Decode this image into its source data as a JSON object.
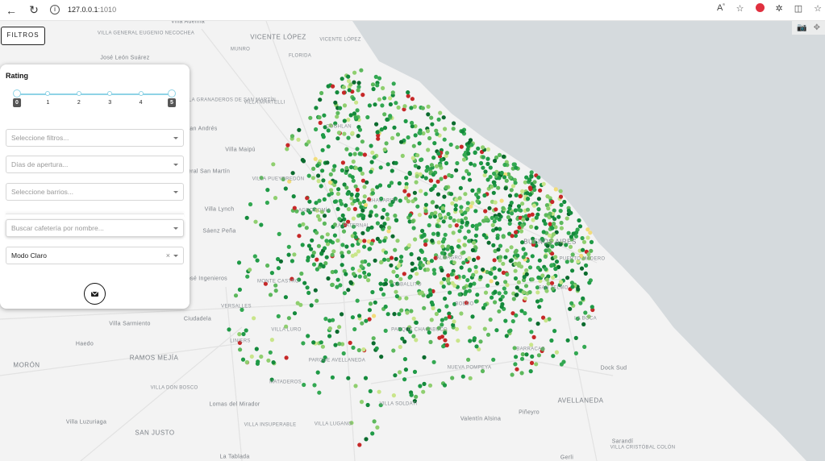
{
  "browser": {
    "url_host": "127.0.0.1",
    "url_port": ":1010",
    "icons": [
      "back-icon",
      "reload-icon",
      "info-icon",
      "read-aloud-icon",
      "favorite-icon",
      "adblock-icon",
      "extensions-icon",
      "split-screen-icon"
    ]
  },
  "toolbar": {
    "filtros_label": "FILTROS"
  },
  "panel": {
    "rating": {
      "title": "Rating",
      "ticks": [
        "0",
        "1",
        "2",
        "3",
        "4",
        "5"
      ],
      "min_selected": 0,
      "max_selected": 5
    },
    "filters_placeholder": "Seleccione filtros...",
    "days_placeholder": "Días de apertura...",
    "barrios_placeholder": "Seleccione barrios...",
    "search_placeholder": "Buscar cafetería por nombre...",
    "mode_value": "Modo Claro",
    "clear_symbol": "×"
  },
  "map": {
    "colors": {
      "land": "#f3f3f3",
      "water": "#d5dadd",
      "dot_palette": [
        "#0b6b2e",
        "#148a3c",
        "#1f9a46",
        "#33a852",
        "#5cb85c",
        "#8fcf6f",
        "#c9e58a",
        "#f2dc7a",
        "#c62828"
      ]
    },
    "labels": [
      "Villa Adelina",
      "Villa General Eugenio Necochea",
      "José León Suárez",
      "VICENTE LÓPEZ",
      "Vicente López",
      "Munro",
      "Florida",
      "Villa Granaderos de San Martín",
      "Villa Martelli",
      "San Andrés",
      "Villa Maipú",
      "General San Martín",
      "Villa Pueyrredón",
      "Villa Lynch",
      "Agronomía",
      "Sáenz Peña",
      "Coghlan",
      "Chacarita",
      "La Paternal",
      "José Ingenieros",
      "Versalles",
      "Monte Castro",
      "Villa Sarmiento",
      "Ciudadela",
      "Haedo",
      "RAMOS MEJÍA",
      "MORÓN",
      "Villa Don Bosco",
      "Lomas del Mirador",
      "Villa Luzuriaga",
      "SAN JUSTO",
      "La Tablada",
      "Liniers",
      "Villa Luro",
      "Parque Avellaneda",
      "Mataderos",
      "Villa Insuperable",
      "Villa Lugano",
      "Almagro",
      "Caballito",
      "Boedo",
      "Parque Chacabuco",
      "Barracas",
      "Nueva Pompeya",
      "Villa Soldati",
      "Valentín Alsina",
      "Piñeyro",
      "AVELLANEDA",
      "Dock Sud",
      "La Boca",
      "Puerto Madero",
      "San Telmo",
      "Sarandí",
      "Villa Cristóbal Colón",
      "Gerli",
      "Buenos Aires"
    ],
    "modebar": {
      "camera": "📷",
      "pan": "✥"
    }
  }
}
